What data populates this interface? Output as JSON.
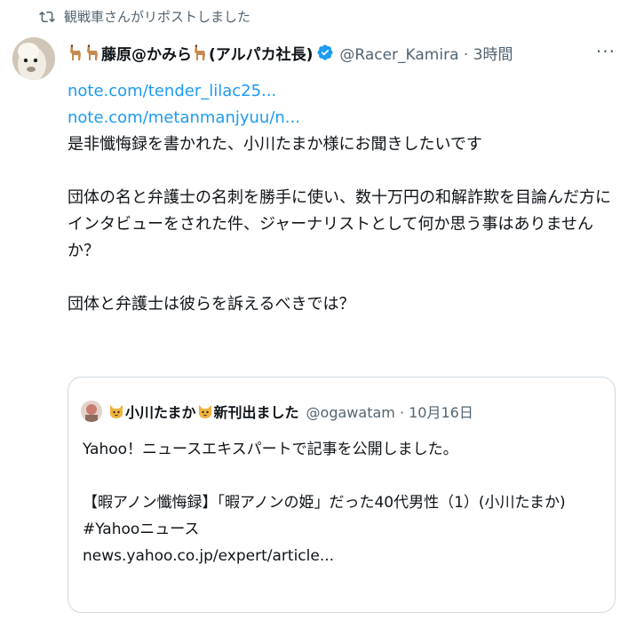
{
  "repost": {
    "label": "観戦車さんがリポストしました"
  },
  "tweet": {
    "display_name": "藤原@かみら",
    "display_name_suffix": "(アルパカ社長)",
    "handle": "@Racer_Kamira · 3時間",
    "more_label": "···",
    "links": [
      "note.com/tender_lilac25...",
      "note.com/metanmanjyuu/n..."
    ],
    "paragraph1": "是非懺悔録を書かれた、小川たまか様にお聞きしたいです",
    "paragraph2_lines": [
      "団体の名と弁護士の名刺を勝手に使い、数十万円の和解詐欺を目論んだ方に",
      "インタビューをされた件、ジャーナリストとして何か思う事はありません",
      "か？"
    ],
    "paragraph3": "団体と弁護士は彼らを訴えるべきでは？"
  },
  "quote": {
    "display_name": "小川たまか",
    "display_name_suffix": "新刊出ました",
    "handle": "@ogawatam · 10月16日",
    "line1": "Yahoo！ニュースエキスパートで記事を公開しました。",
    "line2": "【暇アノン懺悔録】「暇アノンの姫」だった40代男性（1）(小川たまか)",
    "line3": "#Yahooニュース",
    "line4": "news.yahoo.co.jp/expert/article..."
  },
  "icons": {
    "repost": "repost-icon",
    "alpaca": "alpaca-emoji-icon",
    "verified": "verified-badge-icon",
    "cat": "cat-emoji-icon"
  },
  "colors": {
    "link": "#1d9bf0",
    "secondary": "#536471",
    "verified": "#1d9bf0",
    "border": "#cfd9de"
  }
}
